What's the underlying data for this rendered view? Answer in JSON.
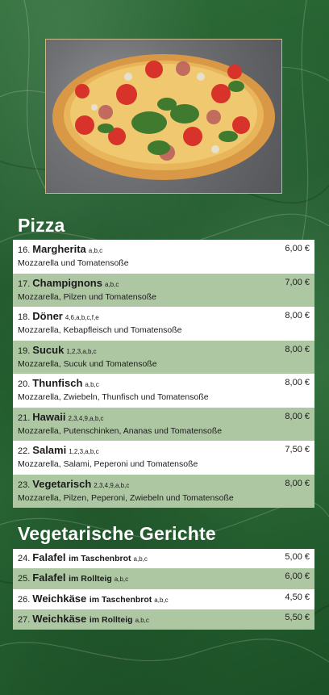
{
  "pizza": {
    "title": "Pizza",
    "items": [
      {
        "num": "16.",
        "name": "Margherita",
        "codes": "a,b,c",
        "desc": "Mozzarella und Tomatensoße",
        "price": "6,00 €"
      },
      {
        "num": "17.",
        "name": "Champignons",
        "codes": "a,b,c",
        "desc": "Mozzarella, Pilzen und Tomatensoße",
        "price": "7,00 €"
      },
      {
        "num": "18.",
        "name": "Döner",
        "codes": "4,6,a,b,c,f,e",
        "desc": "Mozzarella, Kebapfleisch und Tomatensoße",
        "price": "8,00 €"
      },
      {
        "num": "19.",
        "name": "Sucuk",
        "codes": "1,2,3,a,b,c",
        "desc": "Mozzarella, Sucuk und Tomatensoße",
        "price": "8,00 €"
      },
      {
        "num": "20.",
        "name": "Thunfisch",
        "codes": "a,b,c",
        "desc": "Mozzarella, Zwiebeln, Thunfisch und Tomatensoße",
        "price": "8,00 €"
      },
      {
        "num": "21.",
        "name": "Hawaii",
        "codes": "2,3,4,9,a,b,c",
        "desc": "Mozzarella, Putenschinken, Ananas und Tomatensoße",
        "price": "8,00 €"
      },
      {
        "num": "22.",
        "name": "Salami",
        "codes": "1,2,3,a,b,c",
        "desc": "Mozzarella, Salami, Peperoni und Tomatensoße",
        "price": "7,50 €"
      },
      {
        "num": "23.",
        "name": "Vegetarisch",
        "codes": "2,3,4,9,a,b,c",
        "desc": "Mozzarella, Pilzen, Peperoni, Zwiebeln und Tomatensoße",
        "price": "8,00 €"
      }
    ]
  },
  "vegetarian": {
    "title": "Vegetarische Gerichte",
    "items": [
      {
        "num": "24.",
        "name": "Falafel",
        "sub": "im Taschenbrot",
        "codes": "a,b,c",
        "price": "5,00 €"
      },
      {
        "num": "25.",
        "name": "Falafel",
        "sub": "im Rollteig",
        "codes": "a,b,c",
        "price": "6,00 €"
      },
      {
        "num": "26.",
        "name": "Weichkäse",
        "sub": "im Taschenbrot",
        "codes": "a,b,c",
        "price": "4,50 €"
      },
      {
        "num": "27.",
        "name": "Weichkäse",
        "sub": "im Rollteig",
        "codes": "a,b,c",
        "price": "5,50 €"
      }
    ]
  },
  "colors": {
    "background": "#1f5a2b",
    "row_white": "#ffffff",
    "row_green": "#aec7a3",
    "frame": "#c9b98a"
  },
  "image": {
    "icon": "pizza-photo"
  }
}
